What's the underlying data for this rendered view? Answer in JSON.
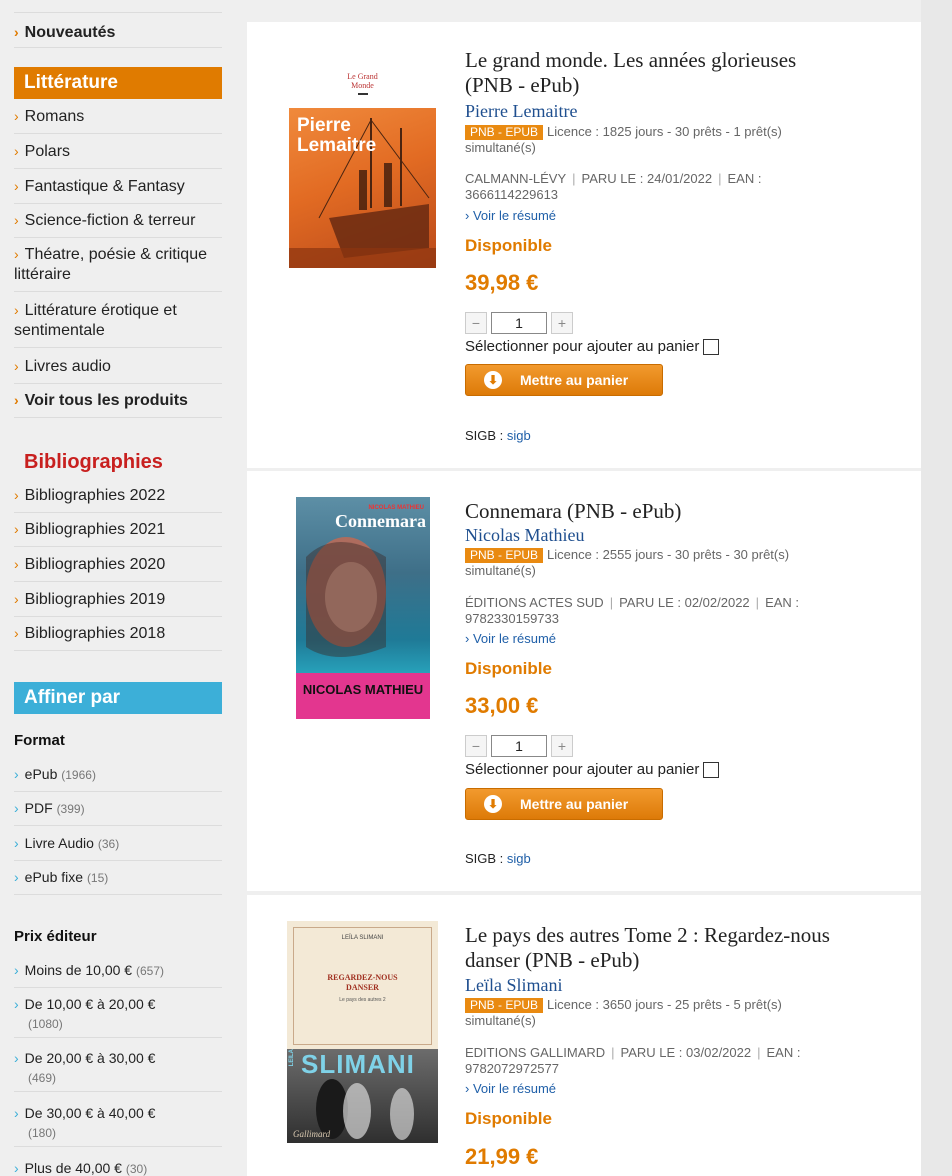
{
  "sidebar": {
    "top_item": "Nouveautés",
    "litterature": {
      "heading": "Littérature",
      "items": [
        {
          "label": "Romans"
        },
        {
          "label": "Polars"
        },
        {
          "label": "Fantastique & Fantasy"
        },
        {
          "label": "Science-fiction & terreur"
        },
        {
          "label": "Théatre, poésie & critique",
          "label2": "littéraire"
        },
        {
          "label": "Littérature érotique et",
          "label2": "sentimentale"
        },
        {
          "label": "Livres audio"
        },
        {
          "label": "Voir tous les produits"
        }
      ]
    },
    "bibliographies": {
      "heading": "Bibliographies",
      "items": [
        "Bibliographies 2022",
        "Bibliographies 2021",
        "Bibliographies 2020",
        "Bibliographies 2019",
        "Bibliographies 2018"
      ]
    },
    "affiner": {
      "heading": "Affiner par",
      "format_title": "Format",
      "formats": [
        {
          "label": "ePub",
          "count": "(1966)"
        },
        {
          "label": "PDF",
          "count": "(399)"
        },
        {
          "label": "Livre Audio",
          "count": "(36)"
        },
        {
          "label": "ePub fixe",
          "count": "(15)"
        }
      ],
      "prix_title": "Prix éditeur",
      "prix": [
        {
          "label": "Moins de 10,00 €",
          "count": "(657)"
        },
        {
          "label": "De 10,00 € à 20,00 €",
          "count": "(1080)"
        },
        {
          "label": "De 20,00 € à 30,00 €",
          "count": "(469)"
        },
        {
          "label": "De 30,00 € à 40,00 €",
          "count": "(180)"
        },
        {
          "label": "Plus de 40,00 €",
          "count": "(30)"
        }
      ]
    }
  },
  "products": [
    {
      "title_line1": "Le grand monde. Les années glorieuses",
      "title_line2": "(PNB - ePub)",
      "author": "Pierre Lemaitre",
      "badge": "PNB - EPUB",
      "licence": "Licence : 1825 jours - 30 prêts - 1 prêt(s)",
      "licence2": "simultané(s)",
      "publisher": "CALMANN-LÉVY",
      "paru": "PARU LE : 24/01/2022",
      "ean_label": "EAN :",
      "ean": "3666114229613",
      "resume": "› Voir le résumé",
      "availability": "Disponible",
      "price": "39,98 €",
      "qty": "1",
      "select_label": "Sélectionner pour ajouter au panier",
      "cart_label": "Mettre au panier",
      "sigb_label": "SIGB :",
      "sigb_link": "sigb",
      "cover_top": "Le Grand",
      "cover_top2": "Monde",
      "cover_author1": "Pierre",
      "cover_author2": "Lemaitre",
      "cover_color": "#e6772e"
    },
    {
      "title_line1": "Connemara (PNB - ePub)",
      "title_line2": "",
      "author": "Nicolas Mathieu",
      "badge": "PNB - EPUB",
      "licence": "Licence : 2555 jours - 30 prêts - 30 prêt(s)",
      "licence2": "simultané(s)",
      "publisher": "ÉDITIONS ACTES SUD",
      "paru": "PARU LE : 02/02/2022",
      "ean_label": "EAN :",
      "ean": "9782330159733",
      "resume": "› Voir le résumé",
      "availability": "Disponible",
      "price": "33,00 €",
      "qty": "1",
      "select_label": "Sélectionner pour ajouter au panier",
      "cart_label": "Mettre au panier",
      "sigb_label": "SIGB :",
      "sigb_link": "sigb",
      "cover_top": "NICOLAS MATHIEU",
      "cover_title": "Connemara",
      "cover_author": "NICOLAS MATHIEU",
      "cover_color": "#e3368f"
    },
    {
      "title_line1": "Le pays des autres Tome 2 : Regardez-nous",
      "title_line2": "danser (PNB - ePub)",
      "author": "Leïla Slimani",
      "badge": "PNB - EPUB",
      "licence": "Licence : 3650 jours - 25 prêts - 5 prêt(s)",
      "licence2": "simultané(s)",
      "publisher": "EDITIONS GALLIMARD",
      "paru": "PARU LE : 03/02/2022",
      "ean_label": "EAN :",
      "ean": "9782072972577",
      "resume": "› Voir le résumé",
      "availability": "Disponible",
      "price": "21,99 €",
      "cover_top": "LEÏLA SLIMANI",
      "cover_title1": "REGARDEZ-NOUS",
      "cover_title2": "DANSER",
      "cover_sub": "Le pays des autres 2",
      "cover_band": "SLIMANI",
      "cover_band_small": "LEÏLA",
      "cover_pub": "Gallimard",
      "cover_color": "#f3e9d6"
    }
  ]
}
